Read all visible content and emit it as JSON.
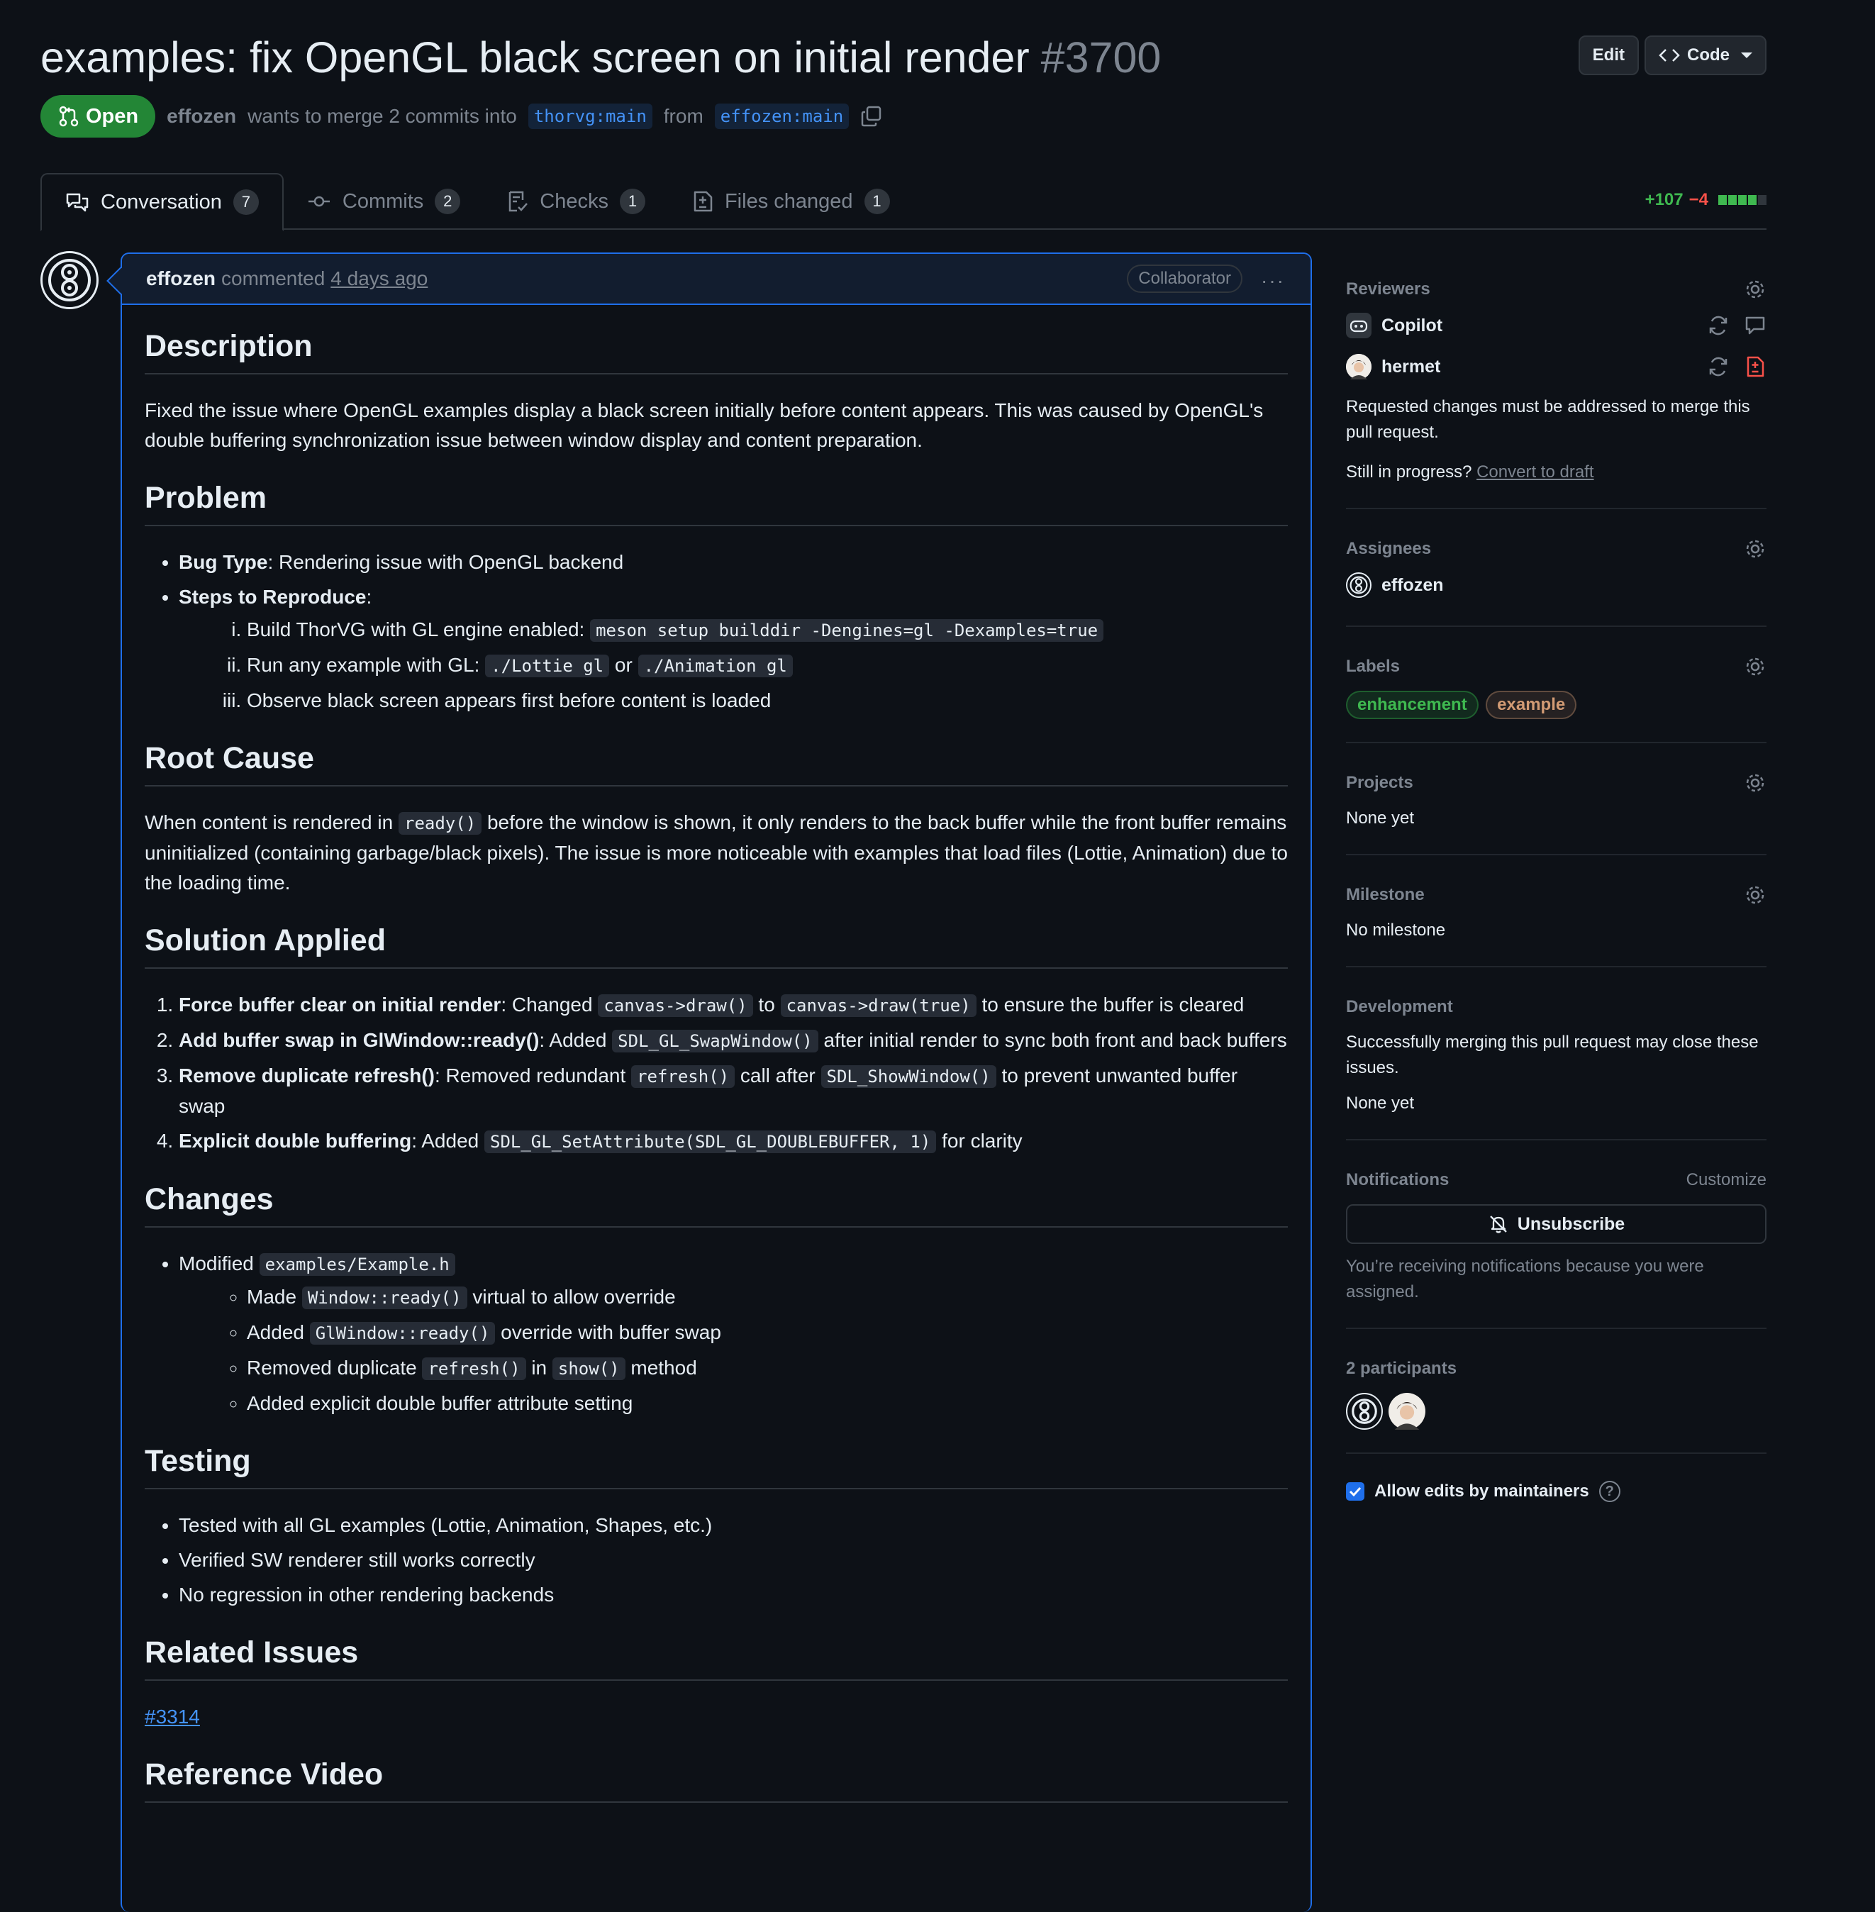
{
  "pr": {
    "title": "examples: fix OpenGL black screen on initial render",
    "number": "#3700",
    "state": "Open",
    "author": "effozen",
    "merge_text": "wants to merge 2 commits into",
    "base_branch": "thorvg:main",
    "from_text": "from",
    "head_branch": "effozen:main"
  },
  "header_actions": {
    "edit": "Edit",
    "code": "Code"
  },
  "tabs": [
    {
      "label": "Conversation",
      "count": "7"
    },
    {
      "label": "Commits",
      "count": "2"
    },
    {
      "label": "Checks",
      "count": "1"
    },
    {
      "label": "Files changed",
      "count": "1"
    }
  ],
  "diffstat": {
    "additions": "+107",
    "deletions": "−4",
    "filled_blocks": 4,
    "total_blocks": 5
  },
  "comment": {
    "author": "effozen",
    "action": "commented",
    "time": "4 days ago",
    "badge": "Collaborator",
    "more": "···",
    "sections": {
      "description": {
        "heading": "Description",
        "text": "Fixed the issue where OpenGL examples display a black screen initially before content appears. This was caused by OpenGL's double buffering synchronization issue between window display and content preparation."
      },
      "problem": {
        "heading": "Problem",
        "bug_label": "Bug Type",
        "bug_text": ": Rendering issue with OpenGL backend",
        "steps_label": "Steps to Reproduce",
        "steps_colon": ":",
        "step1_text": "Build ThorVG with GL engine enabled:",
        "step1_code": "meson setup builddir -Dengines=gl -Dexamples=true",
        "step2_text": "Run any example with GL:",
        "step2_code1": "./Lottie gl",
        "step2_or": "or",
        "step2_code2": "./Animation gl",
        "step3_text": "Observe black screen appears first before content is loaded"
      },
      "root_cause": {
        "heading": "Root Cause",
        "text_a": "When content is rendered in",
        "code": "ready()",
        "text_b": "before the window is shown, it only renders to the back buffer while the front buffer remains uninitialized (containing garbage/black pixels). The issue is more noticeable with examples that load files (Lottie, Animation) due to the loading time."
      },
      "solution": {
        "heading": "Solution Applied",
        "i1_label": "Force buffer clear on initial render",
        "i1_a": ": Changed",
        "i1_code1": "canvas->draw()",
        "i1_b": "to",
        "i1_code2": "canvas->draw(true)",
        "i1_c": "to ensure the buffer is cleared",
        "i2_label": "Add buffer swap in GlWindow::ready()",
        "i2_a": ": Added",
        "i2_code": "SDL_GL_SwapWindow()",
        "i2_b": "after initial render to sync both front and back buffers",
        "i3_label": "Remove duplicate refresh()",
        "i3_a": ": Removed redundant",
        "i3_code1": "refresh()",
        "i3_b": "call after",
        "i3_code2": "SDL_ShowWindow()",
        "i3_c": "to prevent unwanted buffer swap",
        "i4_label": "Explicit double buffering",
        "i4_a": ": Added",
        "i4_code": "SDL_GL_SetAttribute(SDL_GL_DOUBLEBUFFER, 1)",
        "i4_b": "for clarity"
      },
      "changes": {
        "heading": "Changes",
        "modified": "Modified",
        "file": "examples/Example.h",
        "s1_a": "Made",
        "s1_code": "Window::ready()",
        "s1_b": "virtual to allow override",
        "s2_a": "Added",
        "s2_code": "GlWindow::ready()",
        "s2_b": "override with buffer swap",
        "s3_a": "Removed duplicate",
        "s3_code1": "refresh()",
        "s3_b": "in",
        "s3_code2": "show()",
        "s3_c": "method",
        "s4": "Added explicit double buffer attribute setting"
      },
      "testing": {
        "heading": "Testing",
        "items": [
          "Tested with all GL examples (Lottie, Animation, Shapes, etc.)",
          "Verified SW renderer still works correctly",
          "No regression in other rendering backends"
        ]
      },
      "related": {
        "heading": "Related Issues",
        "issue": "#3314"
      },
      "video": {
        "heading": "Reference Video"
      }
    }
  },
  "sidebar": {
    "reviewers": {
      "title": "Reviewers",
      "list": [
        {
          "name": "Copilot"
        },
        {
          "name": "hermet"
        }
      ],
      "note": "Requested changes must be addressed to merge this pull request.",
      "draft_q": "Still in progress?",
      "draft_link": "Convert to draft"
    },
    "assignees": {
      "title": "Assignees",
      "name": "effozen"
    },
    "labels": {
      "title": "Labels",
      "items": [
        "enhancement",
        "example"
      ]
    },
    "projects": {
      "title": "Projects",
      "value": "None yet"
    },
    "milestone": {
      "title": "Milestone",
      "value": "No milestone"
    },
    "development": {
      "title": "Development",
      "text": "Successfully merging this pull request may close these issues.",
      "value": "None yet"
    },
    "notifications": {
      "title": "Notifications",
      "customize": "Customize",
      "button": "Unsubscribe",
      "reason": "You’re receiving notifications because you were assigned."
    },
    "participants": {
      "title": "2 participants"
    },
    "allow_edits": {
      "label": "Allow edits by maintainers",
      "checked": true
    }
  },
  "colors": {
    "accent": "#1f6feb",
    "open_green": "#238636",
    "link": "#4493f8"
  }
}
